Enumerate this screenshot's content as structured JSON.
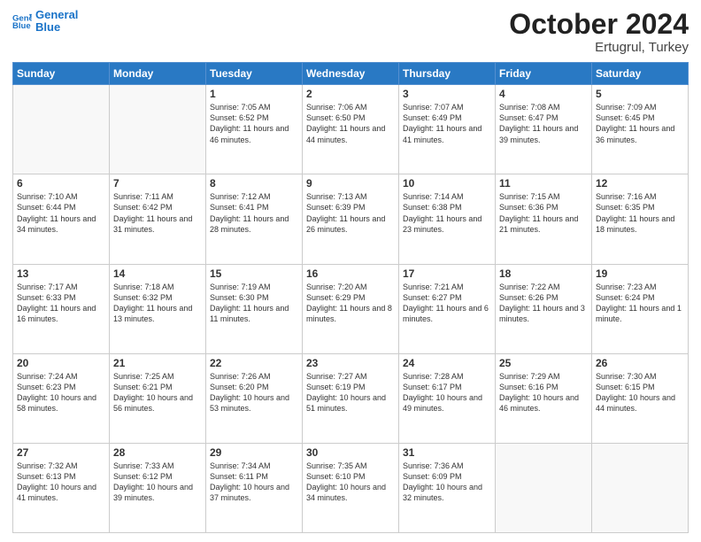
{
  "header": {
    "logo_line1": "General",
    "logo_line2": "Blue",
    "title": "October 2024",
    "subtitle": "Ertugrul, Turkey"
  },
  "days_of_week": [
    "Sunday",
    "Monday",
    "Tuesday",
    "Wednesday",
    "Thursday",
    "Friday",
    "Saturday"
  ],
  "weeks": [
    [
      {
        "num": "",
        "detail": ""
      },
      {
        "num": "",
        "detail": ""
      },
      {
        "num": "1",
        "detail": "Sunrise: 7:05 AM\nSunset: 6:52 PM\nDaylight: 11 hours and 46 minutes."
      },
      {
        "num": "2",
        "detail": "Sunrise: 7:06 AM\nSunset: 6:50 PM\nDaylight: 11 hours and 44 minutes."
      },
      {
        "num": "3",
        "detail": "Sunrise: 7:07 AM\nSunset: 6:49 PM\nDaylight: 11 hours and 41 minutes."
      },
      {
        "num": "4",
        "detail": "Sunrise: 7:08 AM\nSunset: 6:47 PM\nDaylight: 11 hours and 39 minutes."
      },
      {
        "num": "5",
        "detail": "Sunrise: 7:09 AM\nSunset: 6:45 PM\nDaylight: 11 hours and 36 minutes."
      }
    ],
    [
      {
        "num": "6",
        "detail": "Sunrise: 7:10 AM\nSunset: 6:44 PM\nDaylight: 11 hours and 34 minutes."
      },
      {
        "num": "7",
        "detail": "Sunrise: 7:11 AM\nSunset: 6:42 PM\nDaylight: 11 hours and 31 minutes."
      },
      {
        "num": "8",
        "detail": "Sunrise: 7:12 AM\nSunset: 6:41 PM\nDaylight: 11 hours and 28 minutes."
      },
      {
        "num": "9",
        "detail": "Sunrise: 7:13 AM\nSunset: 6:39 PM\nDaylight: 11 hours and 26 minutes."
      },
      {
        "num": "10",
        "detail": "Sunrise: 7:14 AM\nSunset: 6:38 PM\nDaylight: 11 hours and 23 minutes."
      },
      {
        "num": "11",
        "detail": "Sunrise: 7:15 AM\nSunset: 6:36 PM\nDaylight: 11 hours and 21 minutes."
      },
      {
        "num": "12",
        "detail": "Sunrise: 7:16 AM\nSunset: 6:35 PM\nDaylight: 11 hours and 18 minutes."
      }
    ],
    [
      {
        "num": "13",
        "detail": "Sunrise: 7:17 AM\nSunset: 6:33 PM\nDaylight: 11 hours and 16 minutes."
      },
      {
        "num": "14",
        "detail": "Sunrise: 7:18 AM\nSunset: 6:32 PM\nDaylight: 11 hours and 13 minutes."
      },
      {
        "num": "15",
        "detail": "Sunrise: 7:19 AM\nSunset: 6:30 PM\nDaylight: 11 hours and 11 minutes."
      },
      {
        "num": "16",
        "detail": "Sunrise: 7:20 AM\nSunset: 6:29 PM\nDaylight: 11 hours and 8 minutes."
      },
      {
        "num": "17",
        "detail": "Sunrise: 7:21 AM\nSunset: 6:27 PM\nDaylight: 11 hours and 6 minutes."
      },
      {
        "num": "18",
        "detail": "Sunrise: 7:22 AM\nSunset: 6:26 PM\nDaylight: 11 hours and 3 minutes."
      },
      {
        "num": "19",
        "detail": "Sunrise: 7:23 AM\nSunset: 6:24 PM\nDaylight: 11 hours and 1 minute."
      }
    ],
    [
      {
        "num": "20",
        "detail": "Sunrise: 7:24 AM\nSunset: 6:23 PM\nDaylight: 10 hours and 58 minutes."
      },
      {
        "num": "21",
        "detail": "Sunrise: 7:25 AM\nSunset: 6:21 PM\nDaylight: 10 hours and 56 minutes."
      },
      {
        "num": "22",
        "detail": "Sunrise: 7:26 AM\nSunset: 6:20 PM\nDaylight: 10 hours and 53 minutes."
      },
      {
        "num": "23",
        "detail": "Sunrise: 7:27 AM\nSunset: 6:19 PM\nDaylight: 10 hours and 51 minutes."
      },
      {
        "num": "24",
        "detail": "Sunrise: 7:28 AM\nSunset: 6:17 PM\nDaylight: 10 hours and 49 minutes."
      },
      {
        "num": "25",
        "detail": "Sunrise: 7:29 AM\nSunset: 6:16 PM\nDaylight: 10 hours and 46 minutes."
      },
      {
        "num": "26",
        "detail": "Sunrise: 7:30 AM\nSunset: 6:15 PM\nDaylight: 10 hours and 44 minutes."
      }
    ],
    [
      {
        "num": "27",
        "detail": "Sunrise: 7:32 AM\nSunset: 6:13 PM\nDaylight: 10 hours and 41 minutes."
      },
      {
        "num": "28",
        "detail": "Sunrise: 7:33 AM\nSunset: 6:12 PM\nDaylight: 10 hours and 39 minutes."
      },
      {
        "num": "29",
        "detail": "Sunrise: 7:34 AM\nSunset: 6:11 PM\nDaylight: 10 hours and 37 minutes."
      },
      {
        "num": "30",
        "detail": "Sunrise: 7:35 AM\nSunset: 6:10 PM\nDaylight: 10 hours and 34 minutes."
      },
      {
        "num": "31",
        "detail": "Sunrise: 7:36 AM\nSunset: 6:09 PM\nDaylight: 10 hours and 32 minutes."
      },
      {
        "num": "",
        "detail": ""
      },
      {
        "num": "",
        "detail": ""
      }
    ]
  ]
}
